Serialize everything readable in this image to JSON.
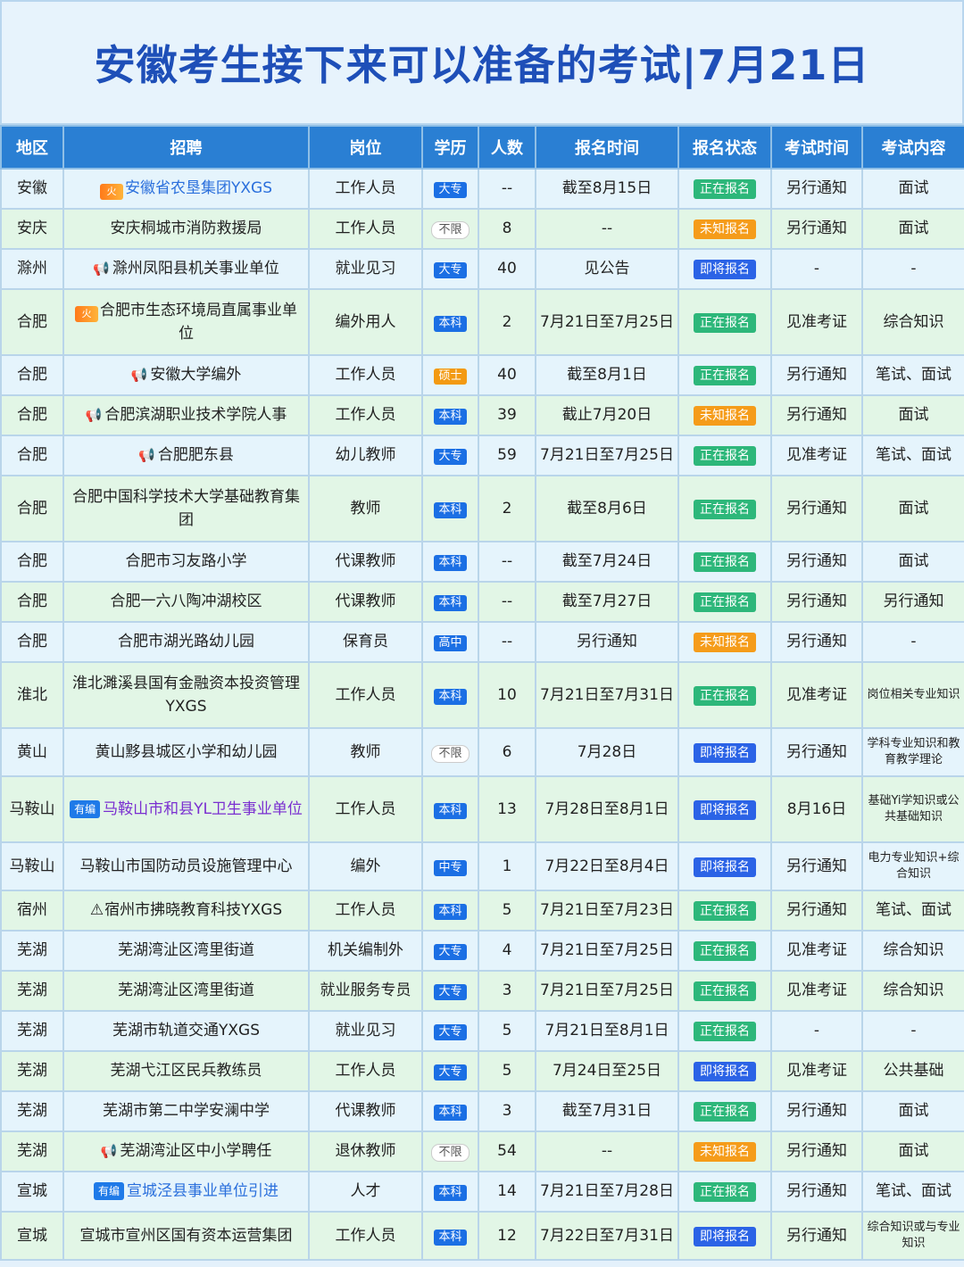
{
  "title": "安徽考生接下来可以准备的考试|7月21日",
  "headers": [
    "地区",
    "招聘",
    "岗位",
    "学历",
    "人数",
    "报名时间",
    "报名状态",
    "考试时间",
    "考试内容"
  ],
  "rows": [
    {
      "region": "安徽",
      "org": "安徽省农垦集团YXGS",
      "prefix": "fire",
      "link": true,
      "position": "工作人员",
      "edu": "大专",
      "count": "--",
      "reg": "截至8月15日",
      "status": "正在报名",
      "examTime": "另行通知",
      "content": "面试"
    },
    {
      "region": "安庆",
      "org": "安庆桐城市消防救援局",
      "position": "工作人员",
      "edu": "不限",
      "count": "8",
      "reg": "--",
      "status": "未知报名",
      "examTime": "另行通知",
      "content": "面试"
    },
    {
      "region": "滁州",
      "org": "滁州凤阳县机关事业单位",
      "prefix": "horn",
      "position": "就业见习",
      "edu": "大专",
      "count": "40",
      "reg": "见公告",
      "status": "即将报名",
      "examTime": "-",
      "content": "-"
    },
    {
      "region": "合肥",
      "org": "合肥市生态环境局直属事业单位",
      "prefix": "fire",
      "tall": true,
      "position": "编外用人",
      "edu": "本科",
      "count": "2",
      "reg": "7月21日至7月25日",
      "status": "正在报名",
      "examTime": "见准考证",
      "content": "综合知识"
    },
    {
      "region": "合肥",
      "org": "安徽大学编外",
      "prefix": "horn",
      "position": "工作人员",
      "edu": "硕士",
      "count": "40",
      "reg": "截至8月1日",
      "status": "正在报名",
      "examTime": "另行通知",
      "content": "笔试、面试"
    },
    {
      "region": "合肥",
      "org": "合肥滨湖职业技术学院人事",
      "prefix": "horn",
      "position": "工作人员",
      "edu": "本科",
      "count": "39",
      "reg": "截止7月20日",
      "status": "未知报名",
      "examTime": "另行通知",
      "content": "面试"
    },
    {
      "region": "合肥",
      "org": "合肥肥东县",
      "prefix": "horn",
      "position": "幼儿教师",
      "edu": "大专",
      "count": "59",
      "reg": "7月21日至7月25日",
      "status": "正在报名",
      "examTime": "见准考证",
      "content": "笔试、面试"
    },
    {
      "region": "合肥",
      "org": "合肥中国科学技术大学基础教育集团",
      "tall": true,
      "position": "教师",
      "edu": "本科",
      "count": "2",
      "reg": "截至8月6日",
      "status": "正在报名",
      "examTime": "另行通知",
      "content": "面试"
    },
    {
      "region": "合肥",
      "org": "合肥市习友路小学",
      "position": "代课教师",
      "edu": "本科",
      "count": "--",
      "reg": "截至7月24日",
      "status": "正在报名",
      "examTime": "另行通知",
      "content": "面试"
    },
    {
      "region": "合肥",
      "org": "合肥一六八陶冲湖校区",
      "position": "代课教师",
      "edu": "本科",
      "count": "--",
      "reg": "截至7月27日",
      "status": "正在报名",
      "examTime": "另行通知",
      "content": "另行通知"
    },
    {
      "region": "合肥",
      "org": "合肥市湖光路幼儿园",
      "position": "保育员",
      "edu": "高中",
      "count": "--",
      "reg": "另行通知",
      "status": "未知报名",
      "examTime": "另行通知",
      "content": "-"
    },
    {
      "region": "淮北",
      "org": "淮北濉溪县国有金融资本投资管理YXGS",
      "tall": true,
      "position": "工作人员",
      "edu": "本科",
      "count": "10",
      "reg": "7月21日至7月31日",
      "status": "正在报名",
      "examTime": "见准考证",
      "content": "岗位相关专业知识",
      "contentSmall": true
    },
    {
      "region": "黄山",
      "org": "黄山黟县城区小学和幼儿园",
      "position": "教师",
      "edu": "不限",
      "count": "6",
      "reg": "7月28日",
      "status": "即将报名",
      "examTime": "另行通知",
      "content": "学科专业知识和教育教学理论",
      "contentSmall": true,
      "mid": true
    },
    {
      "region": "马鞍山",
      "org": "马鞍山市和县YL卫生事业单位",
      "prefix": "tag",
      "tagText": "有编",
      "purple": true,
      "tall": true,
      "position": "工作人员",
      "edu": "本科",
      "count": "13",
      "reg": "7月28日至8月1日",
      "status": "即将报名",
      "examTime": "8月16日",
      "content": "基础Yi学知识或公共基础知识",
      "contentSmall": true
    },
    {
      "region": "马鞍山",
      "org": "马鞍山市国防动员设施管理中心",
      "position": "编外",
      "edu": "中专",
      "count": "1",
      "reg": "7月22日至8月4日",
      "status": "即将报名",
      "examTime": "另行通知",
      "content": "电力专业知识+综合知识",
      "contentSmall": true,
      "mid": true
    },
    {
      "region": "宿州",
      "org": "宿州市拂晓教育科技YXGS",
      "prefix": "warn",
      "position": "工作人员",
      "edu": "本科",
      "count": "5",
      "reg": "7月21日至7月23日",
      "status": "正在报名",
      "examTime": "另行通知",
      "content": "笔试、面试"
    },
    {
      "region": "芜湖",
      "org": "芜湖湾沚区湾里街道",
      "position": "机关编制外",
      "edu": "大专",
      "count": "4",
      "reg": "7月21日至7月25日",
      "status": "正在报名",
      "examTime": "见准考证",
      "content": "综合知识"
    },
    {
      "region": "芜湖",
      "org": "芜湖湾沚区湾里街道",
      "position": "就业服务专员",
      "edu": "大专",
      "count": "3",
      "reg": "7月21日至7月25日",
      "status": "正在报名",
      "examTime": "见准考证",
      "content": "综合知识"
    },
    {
      "region": "芜湖",
      "org": "芜湖市轨道交通YXGS",
      "position": "就业见习",
      "edu": "大专",
      "count": "5",
      "reg": "7月21日至8月1日",
      "status": "正在报名",
      "examTime": "-",
      "content": "-"
    },
    {
      "region": "芜湖",
      "org": "芜湖弋江区民兵教练员",
      "position": "工作人员",
      "edu": "大专",
      "count": "5",
      "reg": "7月24日至25日",
      "status": "即将报名",
      "examTime": "见准考证",
      "content": "公共基础"
    },
    {
      "region": "芜湖",
      "org": "芜湖市第二中学安澜中学",
      "position": "代课教师",
      "edu": "本科",
      "count": "3",
      "reg": "截至7月31日",
      "status": "正在报名",
      "examTime": "另行通知",
      "content": "面试"
    },
    {
      "region": "芜湖",
      "org": "芜湖湾沚区中小学聘任",
      "prefix": "horn",
      "position": "退休教师",
      "edu": "不限",
      "count": "54",
      "reg": "--",
      "status": "未知报名",
      "examTime": "另行通知",
      "content": "面试"
    },
    {
      "region": "宣城",
      "org": "宣城泾县事业单位引进",
      "prefix": "tag",
      "tagText": "有编",
      "link": true,
      "position": "人才",
      "edu": "本科",
      "count": "14",
      "reg": "7月21日至7月28日",
      "status": "正在报名",
      "examTime": "另行通知",
      "content": "笔试、面试"
    },
    {
      "region": "宣城",
      "org": "宣城市宣州区国有资本运营集团",
      "position": "工作人员",
      "edu": "本科",
      "count": "12",
      "reg": "7月22日至7月31日",
      "status": "即将报名",
      "examTime": "另行通知",
      "content": "综合知识或与专业知识",
      "contentSmall": true,
      "mid": true
    }
  ]
}
